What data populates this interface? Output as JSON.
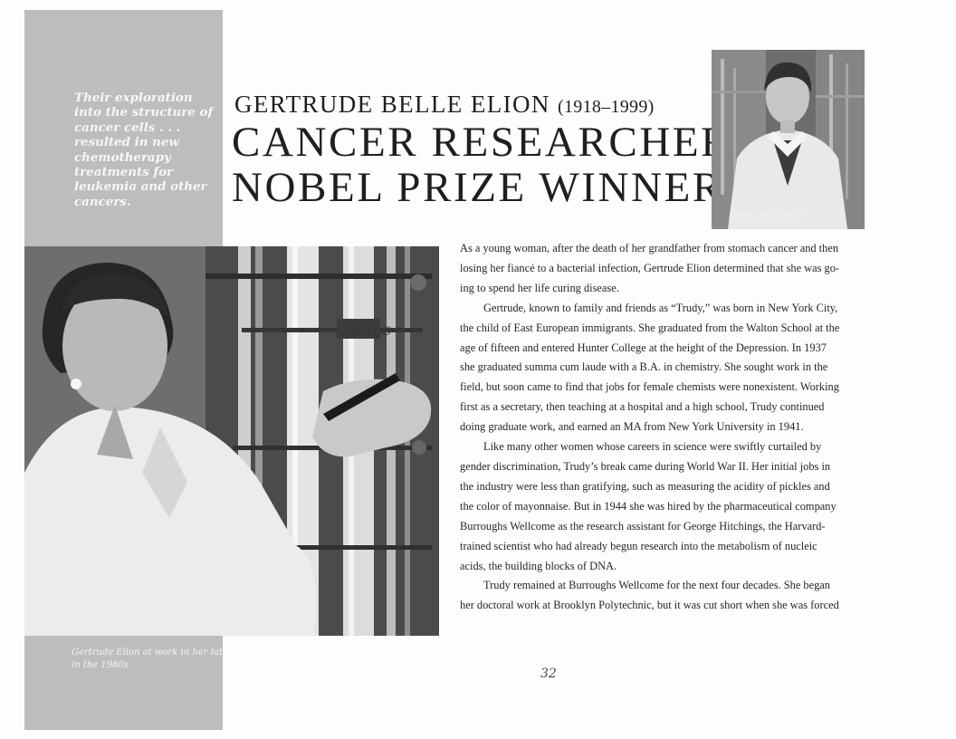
{
  "sidebar": {
    "pull_quote": "Their exploration into the structure of cancer cells . . . resulted in new chemotherapy treatments for leukemia and other cancers."
  },
  "header": {
    "name": "GERTRUDE BELLE ELION",
    "years": "(1918–1999)",
    "title_line1": "CANCER RESEARCHER,",
    "title_line2": "NOBEL PRIZE WINNER"
  },
  "portrait_photo": {
    "caption": "Elion, circa 1950"
  },
  "lab_photo": {
    "caption": "Gertrude Elion at work in her lab in the 1980s",
    "handwriting": "% H₂O"
  },
  "body": {
    "paragraphs": [
      [
        "As a young woman, after the death of her grandfather from stomach cancer and then",
        "losing her fiancé to a bacterial infection, Gertrude Elion determined that she was go-",
        "ing to spend her life curing disease."
      ],
      [
        "Gertrude, known to family and friends as “Trudy,” was born in New York City,",
        "the child of East European immigrants. She graduated from the Walton School at the",
        "age of fifteen and entered Hunter College at the height of the Depression. In 1937",
        "she graduated summa cum laude with a B.A. in chemistry. She sought work in the",
        "field, but soon came to find that jobs for female chemists were nonexistent. Working",
        "first as a secretary, then teaching at a hospital and a high school, Trudy continued",
        "doing graduate work, and earned an MA from New York University in 1941."
      ],
      [
        "Like many other women whose careers in science were swiftly curtailed by",
        "gender discrimination, Trudy’s break came during World War II. Her initial jobs in",
        "the industry were less than gratifying, such as measuring the acidity of pickles and",
        "the color of mayonnaise. But in 1944 she was hired by the pharmaceutical company",
        "Burroughs Wellcome as the research assistant for George Hitchings, the Harvard-",
        "trained scientist who had already begun research into the metabolism of nucleic",
        "acids, the building blocks of DNA."
      ],
      [
        "Trudy remained at Burroughs Wellcome for the next four decades. She began",
        "her doctoral work at Brooklyn Polytechnic, but it was cut short when she was forced"
      ]
    ]
  },
  "footer": {
    "page_number": "32"
  }
}
